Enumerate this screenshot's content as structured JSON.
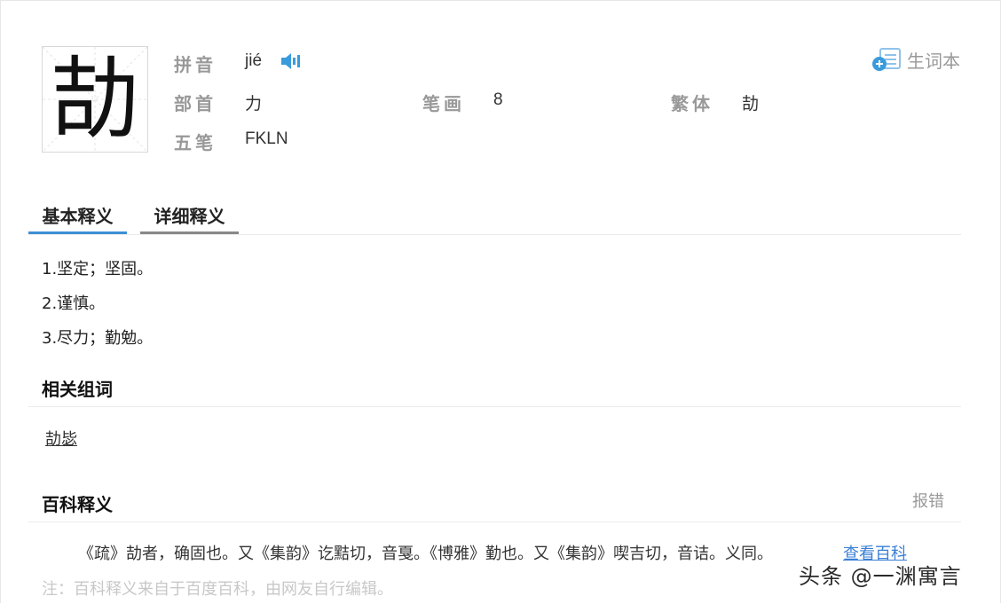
{
  "character": {
    "glyph": "劼",
    "pinyin_label": "拼音",
    "pinyin": "jié",
    "radical_label": "部首",
    "radical": "力",
    "strokes_label": "笔画",
    "strokes": "8",
    "traditional_label": "繁体",
    "traditional": "劼",
    "wubi_label": "五笔",
    "wubi": "FKLN"
  },
  "vocab_button": {
    "label": "生词本"
  },
  "tabs": [
    {
      "label": "基本释义"
    },
    {
      "label": "详细释义"
    }
  ],
  "definitions": [
    "1.坚定；坚固。",
    "2.谨慎。",
    "3.尽力；勤勉。"
  ],
  "related": {
    "title": "相关组词",
    "words": [
      "劼毖"
    ]
  },
  "baike": {
    "title": "百科释义",
    "report_label": "报错",
    "text": "《疏》劼者，确固也。又《集韵》讫黠切，音戛。《博雅》勤也。又《集韵》喫吉切，音诘。义同。",
    "link_label": "查看百科",
    "note": "注：百科释义来自于百度百科，由网友自行编辑。"
  },
  "watermark": "头条 @一渊寓言",
  "colors": {
    "accent": "#3d8fd6",
    "icon_blue": "#3a9bdc",
    "label_gray": "#999999"
  }
}
